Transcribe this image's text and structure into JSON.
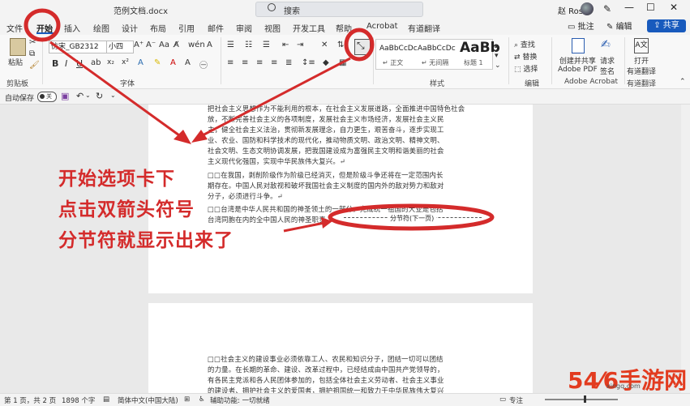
{
  "window": {
    "doc_title": "范例文档.docx",
    "search_label": "搜索",
    "user_name": "赵 Ross",
    "minimize_glyph": "—",
    "maximize_glyph": "☐",
    "close_glyph": "✕"
  },
  "tabs": [
    "文件",
    "开始",
    "插入",
    "绘图",
    "设计",
    "布局",
    "引用",
    "邮件",
    "审阅",
    "视图",
    "开发工具",
    "帮助",
    "Acrobat",
    "有道翻译"
  ],
  "header_buttons": {
    "comment": "批注",
    "edit": "编辑",
    "share": "共享"
  },
  "ribbon": {
    "paste": "粘贴",
    "font_name": "仿宋_GB2312",
    "font_size": "小四",
    "style_samples": [
      {
        "sample": "AaBbCcDc",
        "name": "↵ 正文"
      },
      {
        "sample": "AaBbCcDc",
        "name": "↵ 无间隔"
      },
      {
        "sample": "AaBb",
        "name": "标题 1"
      }
    ],
    "find": "查找",
    "replace": "替换",
    "select": "选择",
    "create_share_pdf": [
      "创建并共享",
      "Adobe PDF"
    ],
    "request_sign": [
      "请求",
      "签名"
    ],
    "open_translate": [
      "打开",
      "有道翻译"
    ],
    "groups": {
      "clipboard": "剪贴板",
      "font": "字体",
      "styles": "样式",
      "editing": "编辑",
      "adobe": "Adobe Acrobat",
      "youdao": "有道翻译"
    }
  },
  "qat": {
    "autosave": "自动保存",
    "autosave_state": "关"
  },
  "document": {
    "page1_lines": [
      "把社会主义思想作为不能利用的根本，在社会主义发展道路，全面推进中国特色社会",
      "放，不断完善社会主义的各项制度，发展社会主义市场经济，发展社会主义民",
      "主，健全社会主义法治，贯彻新发展理念，自力更生，艰苦奋斗，逐步实现工",
      "业、农业、国防和科学技术的现代化，推动物质文明、政治文明、精神文明、",
      "社会文明、生态文明协调发展，把我国建设成为富强民主文明和谐美丽的社会",
      "主义现代化强国，实现中华民族伟大复兴。↵",
      "□□在我国，剥削阶级作为阶级已经消灭，但是阶级斗争还将在一定范围内长",
      "期存在。中国人民对敌视和破坏我国社会主义制度的国内外的敌对势力和敌对",
      "分子，必须进行斗争。↵",
      "□□台湾是中华人民共和国的神圣领土的一部分。完成统一祖国的大业是包括",
      "台湾同胞在内的全中国人民的神圣职责。"
    ],
    "section_break": "分节符(下一页)",
    "page2_lines": [
      "□□社会主义的建设事业必须依靠工人、农民和知识分子，团结一切可以团结",
      "的力量。在长期的革命、建设、改革过程中，已经结成由中国共产党领导的，",
      "有各民主党派和各人民团体参加的，包括全体社会主义劳动者、社会主义事业",
      "的建设者、拥护社会主义的爱国者，拥护祖国统一和致力于中华民族伟大复兴"
    ]
  },
  "annotation": [
    "开始选项卡下",
    "点击双箭头符号",
    "分节符就显示出来了"
  ],
  "status": {
    "page": "第 1 页，共 2 页",
    "words": "1898 个字",
    "language": "简体中文(中国大陆)",
    "accessibility": "辅助功能: 一切就绪",
    "focus": "专注"
  },
  "watermark": {
    "text": "54⁄6手游网",
    "sub": "xingq.com"
  },
  "colors": {
    "annotation_red": "#d42b2b",
    "share_blue": "#185abd"
  }
}
